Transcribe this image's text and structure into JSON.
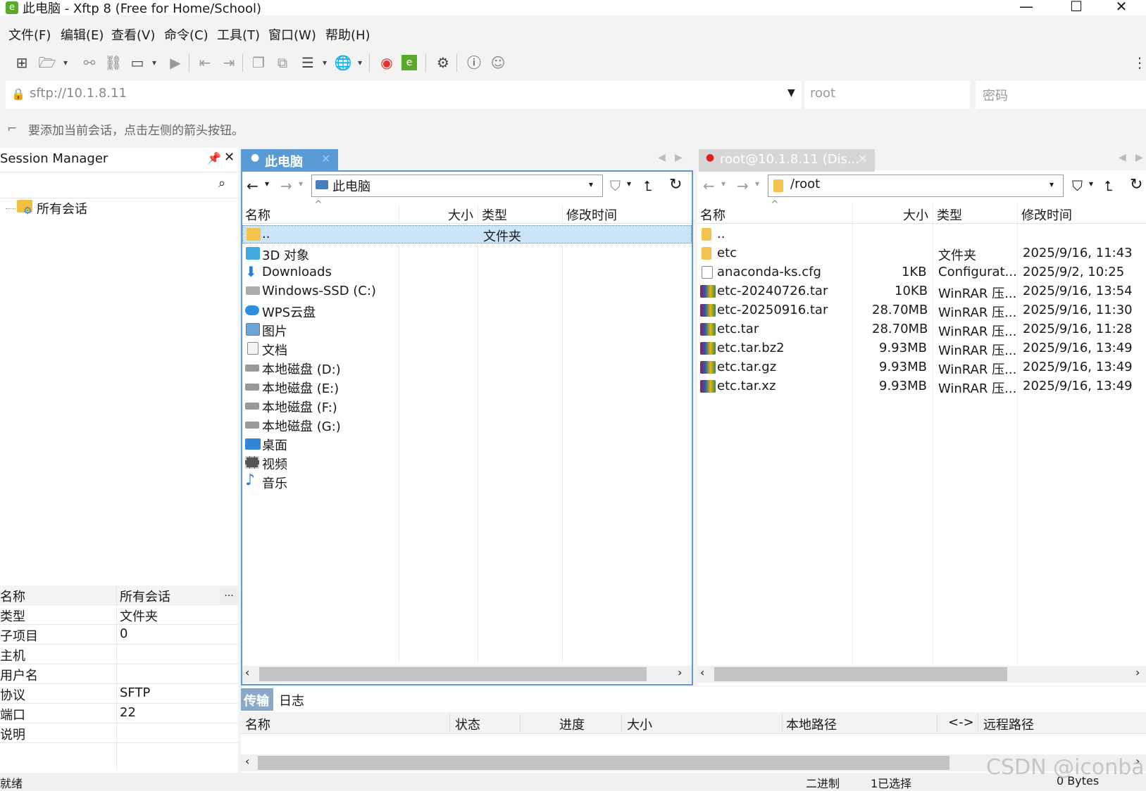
{
  "window": {
    "title": "此电脑 - Xftp 8 (Free for Home/School)",
    "logo": "e",
    "minimize": "—",
    "maximize": "☐",
    "close": "✕"
  },
  "menu": [
    "文件(F)",
    "编辑(E)",
    "查看(V)",
    "命令(C)",
    "工具(T)",
    "窗口(W)",
    "帮助(H)"
  ],
  "address": {
    "value": "sftp://10.1.8.11",
    "user_placeholder": "root",
    "password_placeholder": "密码"
  },
  "hint": "要添加当前会话，点击左侧的箭头按钮。",
  "session_manager": {
    "title": "Session Manager",
    "tree_root": "所有会话",
    "props": [
      {
        "k": "名称",
        "v": "所有会话"
      },
      {
        "k": "类型",
        "v": "文件夹"
      },
      {
        "k": "子项目",
        "v": "0"
      },
      {
        "k": "主机",
        "v": ""
      },
      {
        "k": "用户名",
        "v": ""
      },
      {
        "k": "协议",
        "v": "SFTP"
      },
      {
        "k": "端口",
        "v": "22"
      },
      {
        "k": "说明",
        "v": ""
      }
    ],
    "more": "..."
  },
  "local": {
    "tab": "此电脑",
    "path": "此电脑",
    "columns": {
      "name": "名称",
      "size": "大小",
      "type": "类型",
      "mtime": "修改时间"
    },
    "rows": [
      {
        "name": "..",
        "type": "文件夹",
        "icon": "folder-icon"
      },
      {
        "name": "3D 对象",
        "icon": "cube-icon"
      },
      {
        "name": "Downloads",
        "icon": "download-arrow-icon"
      },
      {
        "name": "Windows-SSD (C:)",
        "icon": "windows-drive-icon"
      },
      {
        "name": "WPS云盘",
        "icon": "cloud-icon"
      },
      {
        "name": "图片",
        "icon": "picture-icon"
      },
      {
        "name": "文档",
        "icon": "document-icon"
      },
      {
        "name": "本地磁盘 (D:)",
        "icon": "drive-icon"
      },
      {
        "name": "本地磁盘 (E:)",
        "icon": "drive-icon"
      },
      {
        "name": "本地磁盘 (F:)",
        "icon": "drive-icon"
      },
      {
        "name": "本地磁盘 (G:)",
        "icon": "drive-icon"
      },
      {
        "name": "桌面",
        "icon": "desktop-icon"
      },
      {
        "name": "视频",
        "icon": "video-icon"
      },
      {
        "name": "音乐",
        "icon": "music-note-icon"
      }
    ]
  },
  "remote": {
    "tab": "root@10.1.8.11 (Dis...",
    "path": "/root",
    "columns": {
      "name": "名称",
      "size": "大小",
      "type": "类型",
      "mtime": "修改时间"
    },
    "rows": [
      {
        "name": "..",
        "size": "",
        "type": "",
        "mtime": "",
        "icon": "folder-icon"
      },
      {
        "name": "etc",
        "size": "",
        "type": "文件夹",
        "mtime": "2025/9/16, 11:43",
        "icon": "folder-icon"
      },
      {
        "name": "anaconda-ks.cfg",
        "size": "1KB",
        "type": "Configurat...",
        "mtime": "2025/9/2, 10:25",
        "icon": "config-file-icon"
      },
      {
        "name": "etc-20240726.tar",
        "size": "10KB",
        "type": "WinRAR 压...",
        "mtime": "2025/9/16, 13:54",
        "icon": "winrar-icon"
      },
      {
        "name": "etc-20250916.tar",
        "size": "28.70MB",
        "type": "WinRAR 压...",
        "mtime": "2025/9/16, 11:30",
        "icon": "winrar-icon"
      },
      {
        "name": "etc.tar",
        "size": "28.70MB",
        "type": "WinRAR 压...",
        "mtime": "2025/9/16, 11:28",
        "icon": "winrar-icon"
      },
      {
        "name": "etc.tar.bz2",
        "size": "9.93MB",
        "type": "WinRAR 压...",
        "mtime": "2025/9/16, 13:49",
        "icon": "winrar-icon"
      },
      {
        "name": "etc.tar.gz",
        "size": "9.93MB",
        "type": "WinRAR 压...",
        "mtime": "2025/9/16, 13:49",
        "icon": "winrar-icon"
      },
      {
        "name": "etc.tar.xz",
        "size": "9.93MB",
        "type": "WinRAR 压...",
        "mtime": "2025/9/16, 13:49",
        "icon": "winrar-icon"
      }
    ]
  },
  "transfer": {
    "tabs": [
      "传输",
      "日志"
    ],
    "columns": [
      "名称",
      "状态",
      "进度",
      "大小",
      "本地路径",
      "<->",
      "远程路径"
    ]
  },
  "status": {
    "ready": "就绪",
    "mode": "二进制",
    "selected": "1已选择",
    "bytes": "0 Bytes"
  },
  "watermark": "CSDN @iconball",
  "colors": {
    "accent": "#5b9bd5",
    "selection": "#cce4f7",
    "disconnected": "#e02020"
  }
}
